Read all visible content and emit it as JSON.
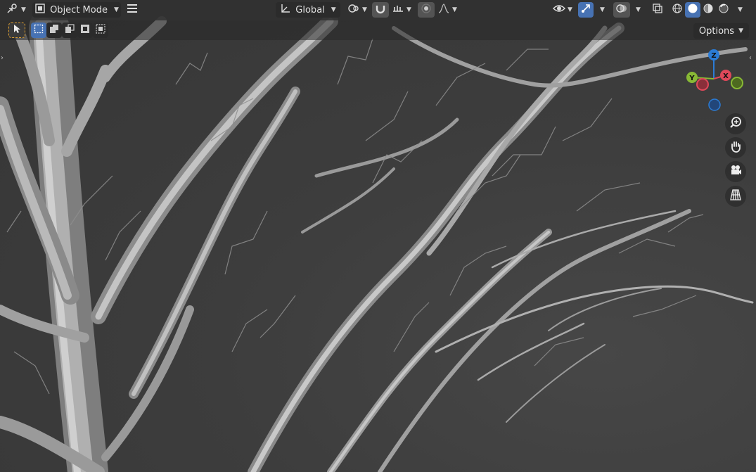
{
  "header": {
    "editor_type_icon": "view3d-icon",
    "mode_icon": "object-mode-icon",
    "mode_label": "Object Mode",
    "menu_icon": "hamburger-menu-icon",
    "transform_orientation_icon": "transform-orientation-icon",
    "transform_orientation_label": "Global",
    "pivot_icon": "pivot-point-icon",
    "snap_icon": "snap-magnet-icon",
    "snap_target_icon": "snap-increment-icon",
    "proportional_icon": "proportional-edit-icon",
    "falloff_icon": "falloff-curve-icon",
    "visibility_icon": "eye-visibility-icon",
    "gizmo_icon": "gizmo-toggle-icon",
    "overlay_icon": "overlays-icon",
    "xray_icon": "xray-icon",
    "shading_modes": [
      "wireframe",
      "solid",
      "material-preview",
      "rendered"
    ],
    "active_shading": "solid"
  },
  "subheader": {
    "select_tool_icon": "select-box-tool-icon",
    "selection_modes": [
      "set-new",
      "extend",
      "subtract",
      "invert",
      "intersect"
    ],
    "options_label": "Options"
  },
  "gizmo": {
    "z_label": "Z",
    "y_label": "Y",
    "x_label": "X",
    "x_color": "#e0485a",
    "y_color": "#88b935",
    "z_color": "#2b7cd6"
  },
  "nav_buttons": [
    "zoom-icon",
    "pan-hand-icon",
    "camera-view-icon",
    "ortho-grid-icon"
  ],
  "colors": {
    "accent": "#4772b3",
    "header_bg": "#303030",
    "viewport_bg": "#3d3d3d"
  }
}
